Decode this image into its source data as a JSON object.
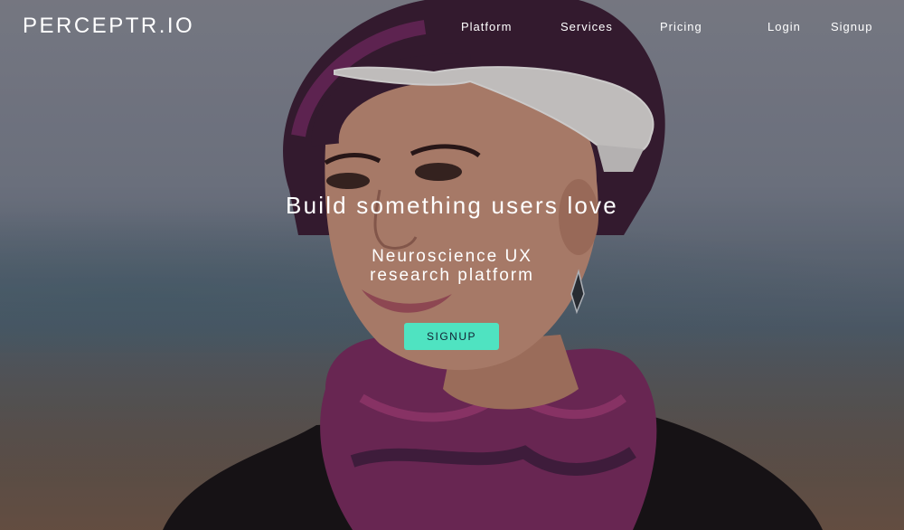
{
  "brand": {
    "name": "PERCEPTR.IO"
  },
  "nav": {
    "platform": "Platform",
    "services": "Services",
    "pricing": "Pricing",
    "login": "Login",
    "signup": "Signup"
  },
  "hero": {
    "headline": "Build something users love",
    "subheadline": "Neuroscience UX research platform",
    "cta": "SIGNUP",
    "cta_color": "#4fe3c1",
    "image_subject": "woman wearing EEG headband"
  }
}
